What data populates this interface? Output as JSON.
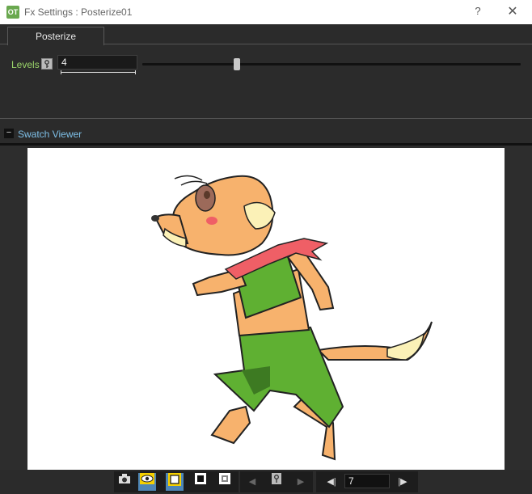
{
  "window": {
    "app_icon_text": "OT",
    "title": "Fx Settings : Posterize01",
    "help_label": "?",
    "close_label": "✕"
  },
  "tabs": [
    {
      "label": "Posterize",
      "active": true
    }
  ],
  "params": {
    "levels": {
      "label": "Levels",
      "value": "4",
      "key_icon": "key-icon",
      "slider_fraction": 0.25
    }
  },
  "swatch_viewer": {
    "label": "Swatch Viewer",
    "collapse_glyph": "−"
  },
  "toolbar": {
    "buttons": [
      {
        "name": "camera-stand-toggle",
        "icon": "camera-icon",
        "active": false
      },
      {
        "name": "preview-toggle",
        "icon": "eye-icon",
        "active": true
      },
      {
        "name": "white-bg-toggle",
        "icon": "white-square-icon",
        "active": true
      },
      {
        "name": "black-bg-toggle",
        "icon": "black-square-icon",
        "active": false
      },
      {
        "name": "checkered-bg-toggle",
        "icon": "checkered-icon",
        "active": false
      },
      {
        "name": "prev-key",
        "icon": "arrow-left-icon",
        "active": false
      },
      {
        "name": "set-key",
        "icon": "key-icon",
        "active": false
      },
      {
        "name": "next-key",
        "icon": "arrow-right-icon",
        "active": false
      },
      {
        "name": "prev-frame",
        "icon": "step-back-icon",
        "active": false
      },
      {
        "name": "next-frame",
        "icon": "step-forward-icon",
        "active": false
      }
    ],
    "frame_value": "7"
  },
  "colors": {
    "accent_green": "#9ad36a",
    "accent_blue": "#7fc0e8",
    "active_button": "#4e86b6",
    "background": "#2b2b2b"
  }
}
